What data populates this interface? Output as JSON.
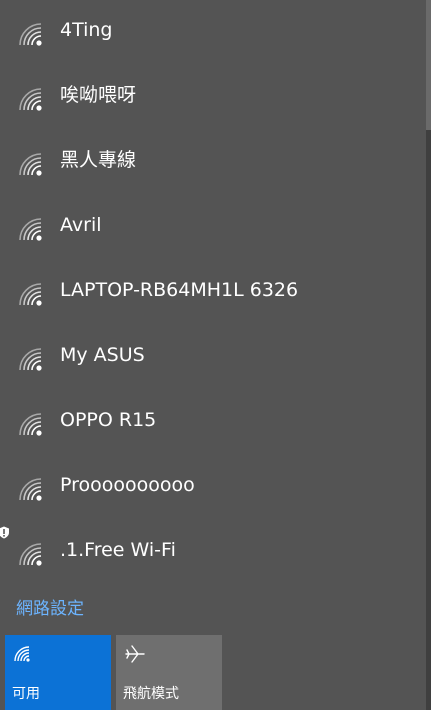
{
  "networks": [
    {
      "name": "4Ting",
      "icon": "wifi-signal-icon",
      "secured": false
    },
    {
      "name": "唉呦喂呀",
      "icon": "wifi-signal-icon",
      "secured": false
    },
    {
      "name": "黑人專線",
      "icon": "wifi-signal-icon",
      "secured": false
    },
    {
      "name": "Avril",
      "icon": "wifi-signal-icon",
      "secured": false
    },
    {
      "name": "LAPTOP-RB64MH1L 6326",
      "icon": "wifi-signal-icon",
      "secured": false
    },
    {
      "name": "My ASUS",
      "icon": "wifi-signal-icon",
      "secured": false
    },
    {
      "name": "OPPO R15",
      "icon": "wifi-signal-icon",
      "secured": false
    },
    {
      "name": "Proooooooooo",
      "icon": "wifi-signal-icon",
      "secured": false
    },
    {
      "name": ".1.Free Wi-Fi",
      "icon": "wifi-signal-icon",
      "secured": false,
      "warning": true
    }
  ],
  "settings_link": "網路設定",
  "tiles": {
    "wifi": {
      "label": "可用",
      "icon": "wifi-icon",
      "color": "#0c72d6"
    },
    "airplane": {
      "label": "飛航模式",
      "icon": "airplane-icon",
      "color": "#6f6f6f"
    }
  }
}
